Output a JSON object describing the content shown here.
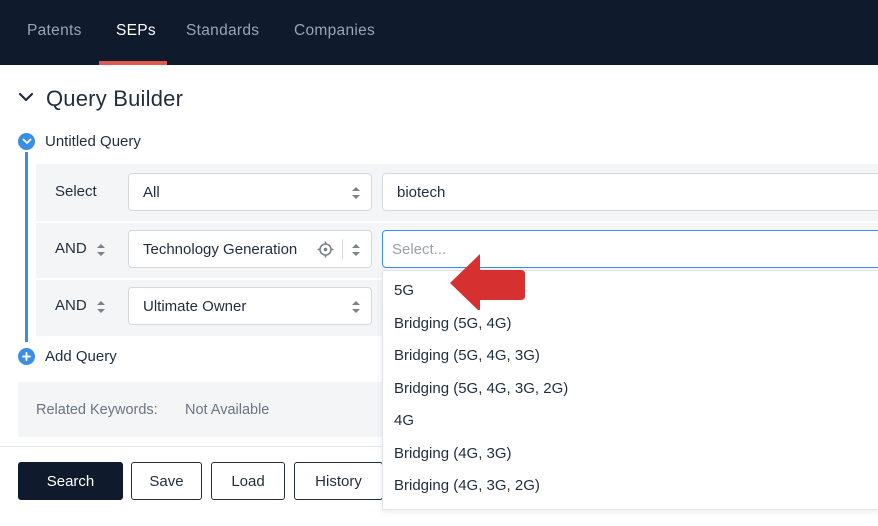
{
  "nav": {
    "tabs": [
      {
        "label": "Patents",
        "active": false
      },
      {
        "label": "SEPs",
        "active": true
      },
      {
        "label": "Standards",
        "active": false
      },
      {
        "label": "Companies",
        "active": false
      }
    ]
  },
  "query_builder": {
    "title": "Query Builder",
    "query_name": "Untitled Query",
    "rows": [
      {
        "label": "Select",
        "field": "All",
        "value": "biotech",
        "placeholder": ""
      },
      {
        "label": "AND",
        "field": "Technology Generation",
        "value": "",
        "placeholder": "Select..."
      },
      {
        "label": "AND",
        "field": "Ultimate Owner",
        "value": "",
        "placeholder": ""
      }
    ],
    "add_query_label": "Add Query",
    "related_keywords_label": "Related Keywords:",
    "related_keywords_value": "Not Available"
  },
  "dropdown": {
    "options": [
      "5G",
      "Bridging (5G, 4G)",
      "Bridging (5G, 4G, 3G)",
      "Bridging (5G, 4G, 3G, 2G)",
      "4G",
      "Bridging (4G, 3G)",
      "Bridging (4G, 3G, 2G)"
    ]
  },
  "buttons": {
    "search": "Search",
    "save": "Save",
    "load": "Load",
    "history": "History"
  },
  "colors": {
    "nav_bg": "#0f1a2c",
    "accent_blue": "#3a8ee6",
    "active_tab_underline": "#e05a4f",
    "annotation_arrow": "#d63031"
  }
}
